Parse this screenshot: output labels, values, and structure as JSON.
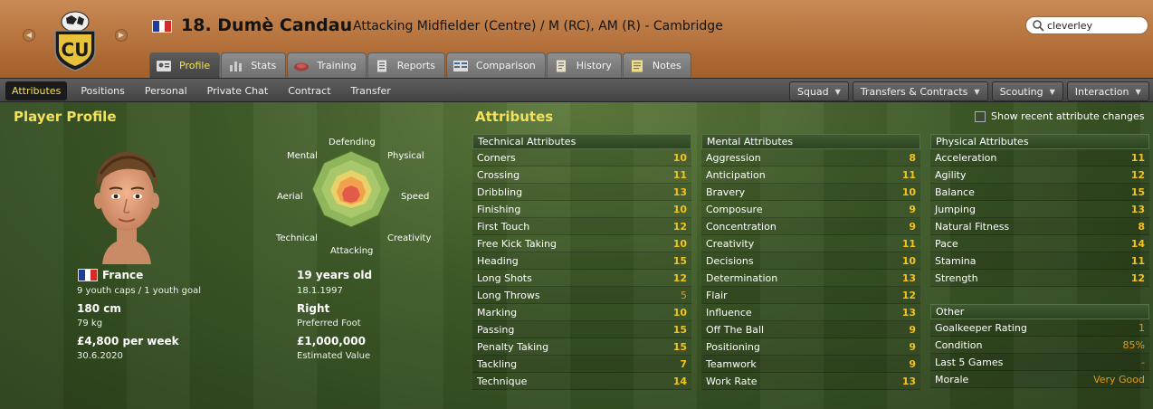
{
  "header": {
    "player_name": "18. Dumè Candau",
    "player_subtitle": "Attacking Midfielder (Centre) / M (RC), AM (R) - Cambridge",
    "crest_text": "CU",
    "search": {
      "value": "cleverley",
      "placeholder": ""
    }
  },
  "main_tabs": [
    {
      "label": "Profile",
      "icon": "profile-icon",
      "active": true
    },
    {
      "label": "Stats",
      "icon": "stats-icon"
    },
    {
      "label": "Training",
      "icon": "training-icon"
    },
    {
      "label": "Reports",
      "icon": "reports-icon"
    },
    {
      "label": "Comparison",
      "icon": "comparison-icon"
    },
    {
      "label": "History",
      "icon": "history-icon"
    },
    {
      "label": "Notes",
      "icon": "notes-icon"
    }
  ],
  "sub_tabs": [
    {
      "label": "Attributes",
      "active": true
    },
    {
      "label": "Positions"
    },
    {
      "label": "Personal"
    },
    {
      "label": "Private Chat"
    },
    {
      "label": "Contract"
    },
    {
      "label": "Transfer"
    }
  ],
  "menus": [
    {
      "label": "Squad"
    },
    {
      "label": "Transfers & Contracts"
    },
    {
      "label": "Scouting"
    },
    {
      "label": "Interaction"
    }
  ],
  "profile": {
    "title": "Player Profile",
    "radar_labels": {
      "defending": "Defending",
      "physical": "Physical",
      "speed": "Speed",
      "creativity": "Creativity",
      "attacking": "Attacking",
      "technical": "Technical",
      "aerial": "Aerial",
      "mental": "Mental"
    },
    "nationality": "France",
    "caps": "9 youth caps / 1 youth goal",
    "age": "19 years old",
    "dob": "18.1.1997",
    "height": "180 cm",
    "weight": "79 kg",
    "foot": "Right",
    "foot_label": "Preferred Foot",
    "wage": "£4,800 per week",
    "contract_end": "30.6.2020",
    "value": "£1,000,000",
    "value_label": "Estimated Value"
  },
  "attributes": {
    "title": "Attributes",
    "recent_label": "Show recent attribute changes",
    "technical": {
      "header": "Technical Attributes",
      "rows": [
        {
          "name": "Corners",
          "value": "10"
        },
        {
          "name": "Crossing",
          "value": "11"
        },
        {
          "name": "Dribbling",
          "value": "13"
        },
        {
          "name": "Finishing",
          "value": "10"
        },
        {
          "name": "First Touch",
          "value": "12"
        },
        {
          "name": "Free Kick Taking",
          "value": "10"
        },
        {
          "name": "Heading",
          "value": "15"
        },
        {
          "name": "Long Shots",
          "value": "12"
        },
        {
          "name": "Long Throws",
          "value": "5"
        },
        {
          "name": "Marking",
          "value": "10"
        },
        {
          "name": "Passing",
          "value": "15"
        },
        {
          "name": "Penalty Taking",
          "value": "15"
        },
        {
          "name": "Tackling",
          "value": "7"
        },
        {
          "name": "Technique",
          "value": "14"
        }
      ]
    },
    "mental": {
      "header": "Mental Attributes",
      "rows": [
        {
          "name": "Aggression",
          "value": "8"
        },
        {
          "name": "Anticipation",
          "value": "11"
        },
        {
          "name": "Bravery",
          "value": "10"
        },
        {
          "name": "Composure",
          "value": "9"
        },
        {
          "name": "Concentration",
          "value": "9"
        },
        {
          "name": "Creativity",
          "value": "11"
        },
        {
          "name": "Decisions",
          "value": "10"
        },
        {
          "name": "Determination",
          "value": "13"
        },
        {
          "name": "Flair",
          "value": "12"
        },
        {
          "name": "Influence",
          "value": "13"
        },
        {
          "name": "Off The Ball",
          "value": "9"
        },
        {
          "name": "Positioning",
          "value": "9"
        },
        {
          "name": "Teamwork",
          "value": "9"
        },
        {
          "name": "Work Rate",
          "value": "13"
        }
      ]
    },
    "physical": {
      "header": "Physical Attributes",
      "rows": [
        {
          "name": "Acceleration",
          "value": "11"
        },
        {
          "name": "Agility",
          "value": "12"
        },
        {
          "name": "Balance",
          "value": "15"
        },
        {
          "name": "Jumping",
          "value": "13"
        },
        {
          "name": "Natural Fitness",
          "value": "8"
        },
        {
          "name": "Pace",
          "value": "14"
        },
        {
          "name": "Stamina",
          "value": "11"
        },
        {
          "name": "Strength",
          "value": "12"
        }
      ]
    },
    "other": {
      "header": "Other",
      "rows": [
        {
          "name": "Goalkeeper Rating",
          "value": "1"
        },
        {
          "name": "Condition",
          "value": "85%"
        },
        {
          "name": "Last 5 Games",
          "value": "-"
        },
        {
          "name": "Morale",
          "value": "Very Good"
        }
      ]
    }
  }
}
